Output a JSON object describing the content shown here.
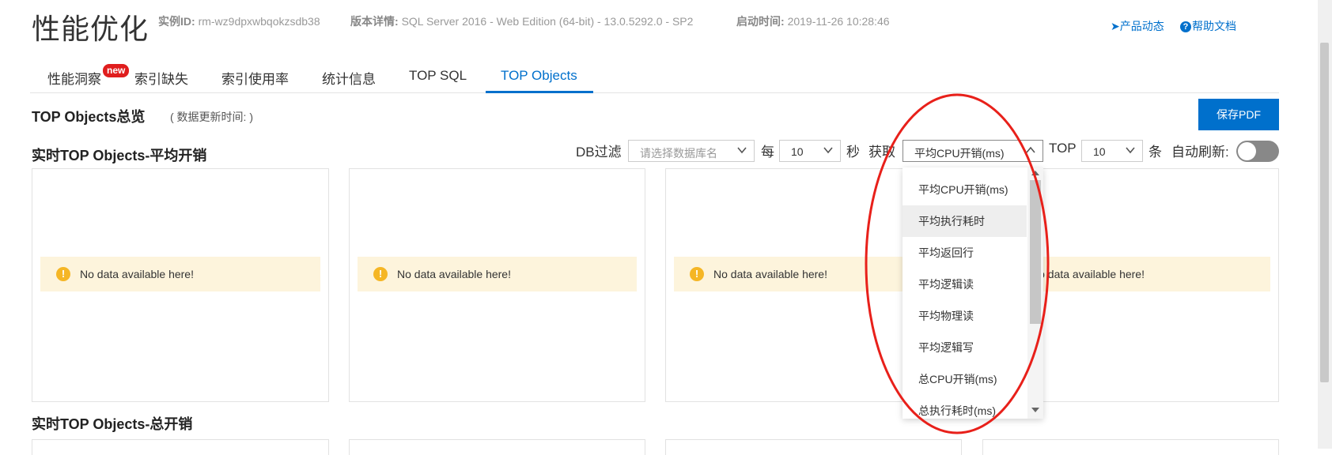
{
  "header": {
    "title": "性能优化",
    "instance_label": "实例ID:",
    "instance_value": "rm-wz9dpxwbqokzsdb38",
    "version_label": "版本详情:",
    "version_value": "SQL Server 2016 - Web Edition (64-bit) - 13.0.5292.0 - SP2",
    "start_label": "启动时间:",
    "start_value": "2019-11-26 10:28:46",
    "link_product_news": "产品动态",
    "link_help_docs": "帮助文档"
  },
  "tabs": [
    {
      "label": "性能洞察",
      "badge": "new"
    },
    {
      "label": "索引缺失"
    },
    {
      "label": "索引使用率"
    },
    {
      "label": "统计信息"
    },
    {
      "label": "TOP SQL"
    },
    {
      "label": "TOP Objects",
      "active": true
    }
  ],
  "overview": {
    "title": "TOP Objects总览",
    "update_time": "( 数据更新时间: )",
    "save_pdf": "保存PDF"
  },
  "avg_section": {
    "title": "实时TOP Objects-平均开销"
  },
  "total_section": {
    "title": "实时TOP Objects-总开销"
  },
  "controls": {
    "db_filter_label": "DB过滤",
    "db_filter_placeholder": "请选择数据库名",
    "every_label": "每",
    "interval_value": "10",
    "seconds_label": "秒",
    "fetch_label": "获取",
    "metric_value": "平均CPU开销(ms)",
    "top_label": "TOP",
    "top_value": "10",
    "count_unit": "条",
    "auto_refresh_label": "自动刷新:"
  },
  "panels": [
    {
      "message": "No data available here!"
    },
    {
      "message": "No data available here!"
    },
    {
      "message": "No data available here!"
    },
    {
      "message": "No data available here!"
    }
  ],
  "metric_dropdown": {
    "options": [
      "平均CPU开销(ms)",
      "平均执行耗时",
      "平均返回行",
      "平均逻辑读",
      "平均物理读",
      "平均逻辑写",
      "总CPU开销(ms)",
      "总执行耗时(ms)"
    ],
    "hovered_option": "平均执行耗时"
  },
  "colors": {
    "accent": "#0070cc",
    "badge": "#e01e1e",
    "warning_bg": "#fdf4dc",
    "warning_icon": "#f5b625",
    "annotation": "#e8201a"
  },
  "icons": [
    "arrow-right-icon",
    "help-circle-icon",
    "chevron-down-icon",
    "chevron-up-icon",
    "warning-icon"
  ]
}
